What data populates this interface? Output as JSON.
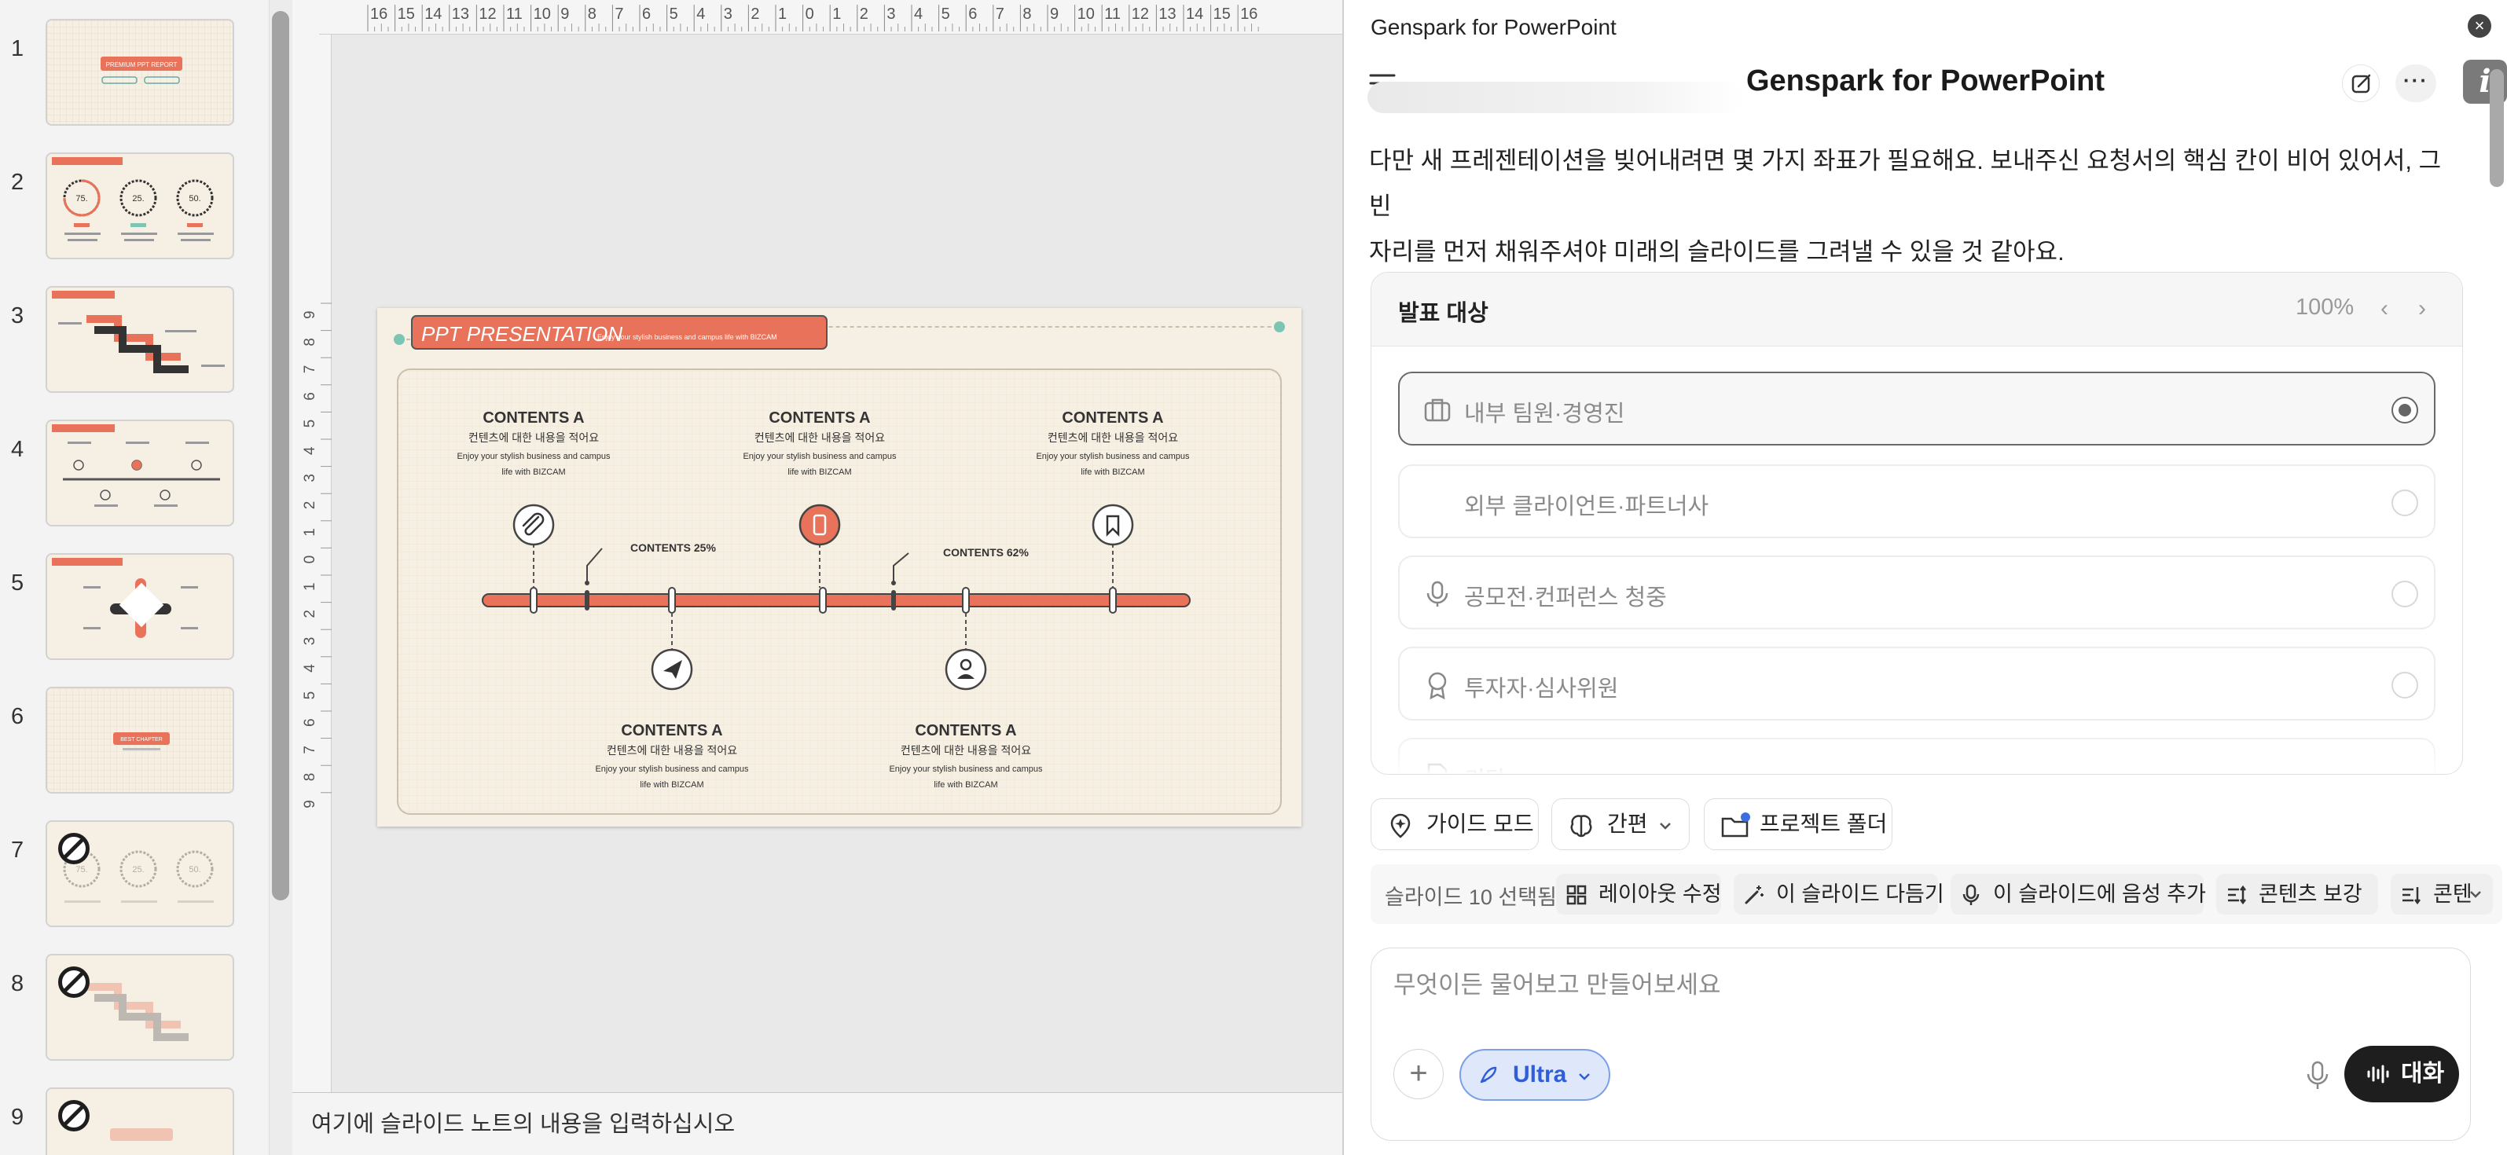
{
  "thumbnails": [
    {
      "number": "1",
      "title": "PREMIUM PPT REPORT",
      "hidden": false
    },
    {
      "number": "2",
      "title": "",
      "hidden": false
    },
    {
      "number": "3",
      "title": "",
      "hidden": false
    },
    {
      "number": "4",
      "title": "",
      "hidden": false
    },
    {
      "number": "5",
      "title": "",
      "hidden": false
    },
    {
      "number": "6",
      "title": "BEST CHAPTER",
      "hidden": false
    },
    {
      "number": "7",
      "title": "",
      "hidden": true
    },
    {
      "number": "8",
      "title": "",
      "hidden": true
    },
    {
      "number": "9",
      "title": "",
      "hidden": true
    }
  ],
  "ruler": {
    "h_labels": [
      "16",
      "15",
      "14",
      "13",
      "12",
      "11",
      "10",
      "9",
      "8",
      "7",
      "6",
      "5",
      "4",
      "3",
      "2",
      "1",
      "0",
      "1",
      "2",
      "3",
      "4",
      "5",
      "6",
      "7",
      "8",
      "9",
      "10",
      "11",
      "12",
      "13",
      "14",
      "15",
      "16"
    ],
    "v_labels": [
      "9",
      "8",
      "7",
      "6",
      "5",
      "4",
      "3",
      "2",
      "1",
      "0",
      "1",
      "2",
      "3",
      "4",
      "5",
      "6",
      "7",
      "8",
      "9"
    ]
  },
  "slide": {
    "header_title": "PPT PRESENTATION",
    "header_subtitle": "Enjoy your stylish business and campus life with BIZCAM",
    "top_items": [
      {
        "title": "CONTENTS A",
        "kr": "컨텐츠에 대한 내용을 적어요",
        "desc1": "Enjoy your stylish business and campus",
        "desc2": "life with BIZCAM",
        "icon": "paperclip-icon",
        "highlight": false
      },
      {
        "title": "CONTENTS A",
        "kr": "컨텐츠에 대한 내용을 적어요",
        "desc1": "Enjoy your stylish business and campus",
        "desc2": "life with BIZCAM",
        "icon": "phone-icon",
        "highlight": true
      },
      {
        "title": "CONTENTS A",
        "kr": "컨텐츠에 대한 내용을 적어요",
        "desc1": "Enjoy your stylish business and campus",
        "desc2": "life with BIZCAM",
        "icon": "bookmark-icon",
        "highlight": false
      }
    ],
    "bottom_items": [
      {
        "title": "CONTENTS A",
        "kr": "컨텐츠에 대한 내용을 적어요",
        "desc1": "Enjoy your stylish business and campus",
        "desc2": "life with BIZCAM",
        "icon": "paper-plane-icon"
      },
      {
        "title": "CONTENTS A",
        "kr": "컨텐츠에 대한 내용을 적어요",
        "desc1": "Enjoy your stylish business and campus",
        "desc2": "life with BIZCAM",
        "icon": "person-icon"
      }
    ],
    "callouts": [
      "CONTENTS 25%",
      "CONTENTS 62%"
    ]
  },
  "notes_placeholder": "여기에 슬라이드 노트의 내용을 입력하십시오",
  "panel": {
    "titlebar": "Genspark for PowerPoint",
    "app_title": "Genspark for PowerPoint",
    "info_label": "i",
    "more_label": "···",
    "message_line1": "다만 새 프레젠테이션을 빚어내려면 몇 가지 좌표가 필요해요. 보내주신 요청서의 핵심 칸이 비어 있어서, 그 빈",
    "message_line2": "자리를 먼저 채워주셔야 미래의 슬라이드를 그려낼 수 있을 것 같아요.",
    "question": {
      "title": "발표 대상",
      "progress": "100%",
      "options": [
        {
          "label": "내부 팀원·경영진",
          "icon": "briefcase-icon",
          "selected": true
        },
        {
          "label": "외부 클라이언트·파트너사",
          "icon": "",
          "selected": false
        },
        {
          "label": "공모전·컨퍼런스 청중",
          "icon": "microphone-icon",
          "selected": false
        },
        {
          "label": "투자자·심사위원",
          "icon": "award-icon",
          "selected": false
        },
        {
          "label": "기타",
          "icon": "document-icon",
          "selected": false
        }
      ]
    },
    "chips": {
      "guide": "가이드 모드",
      "style": "간편",
      "project": "프로젝트 폴더"
    },
    "toolbar": {
      "selected": "슬라이드 10 선택됨",
      "layout": "레이아웃 수정",
      "polish": "이 슬라이드 다듬기",
      "voice": "이 슬라이드에 음성 추가",
      "content": "콘텐츠 보강",
      "more": "콘텐"
    },
    "composer": {
      "placeholder": "무엇이든 물어보고 만들어보세요",
      "model": "Ultra",
      "talk": "대화"
    }
  },
  "colors": {
    "accent": "#e8735a",
    "slide_bg": "#f6efe3",
    "teal": "#7bc5b2",
    "model_blue": "#2f5ed8",
    "dark": "#1e1e1e"
  }
}
